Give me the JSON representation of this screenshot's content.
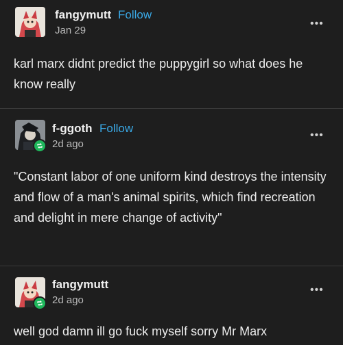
{
  "posts": [
    {
      "username": "fangymutt",
      "follow_label": "Follow",
      "date": "Jan 29",
      "text": "karl marx didnt predict the puppygirl so what does he know really",
      "more_label": "•••"
    },
    {
      "username": "f-ggoth",
      "follow_label": "Follow",
      "date": "2d ago",
      "text": "\"Constant labor of one uniform kind destroys the intensity and flow of a man's animal spirits, which find recreation and delight in mere change of activity\"",
      "more_label": "•••"
    },
    {
      "username": "fangymutt",
      "date": "2d ago",
      "text": "well god damn ill go fuck myself sorry Mr Marx",
      "more_label": "•••"
    }
  ],
  "icons": {
    "reblog": "reblog-icon",
    "more": "more-options-icon"
  },
  "colors": {
    "background": "#1e1e1e",
    "follow": "#3aa9e6",
    "reblog_badge": "#1fb85c"
  }
}
